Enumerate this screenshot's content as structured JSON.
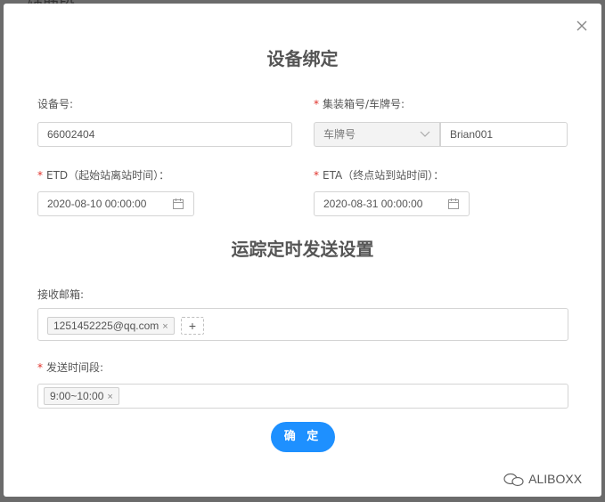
{
  "background": {
    "partial_text": "辅助段"
  },
  "modal": {
    "title_binding": "设备绑定",
    "title_schedule": "运踪定时发送设置",
    "confirm_label": "确 定"
  },
  "fields": {
    "device_no": {
      "label": "设备号:",
      "value": "66002404"
    },
    "container_plate": {
      "label": "集装箱号/车牌号:",
      "select_value": "车牌号",
      "value": "Brian001"
    },
    "etd": {
      "label": "ETD（起始站离站时间）：",
      "value": "2020-08-10 00:00:00"
    },
    "eta": {
      "label": "ETA（终点站到站时间）：",
      "value": "2020-08-31 00:00:00"
    },
    "email": {
      "label": "接收邮箱:",
      "tags": [
        "1251452225@qq.com"
      ],
      "add_label": "+"
    },
    "send_time": {
      "label": "发送时间段:",
      "tags": [
        "9:00~10:00"
      ]
    }
  },
  "watermark": {
    "text": "ALIBOXX"
  },
  "colors": {
    "primary": "#1e90ff",
    "required": "#e0312a",
    "overlay": "#6b6b6b"
  },
  "icons": [
    "close-icon",
    "chevron-down-icon",
    "calendar-icon",
    "tag-close-icon",
    "plus-icon",
    "wechat-icon"
  ]
}
